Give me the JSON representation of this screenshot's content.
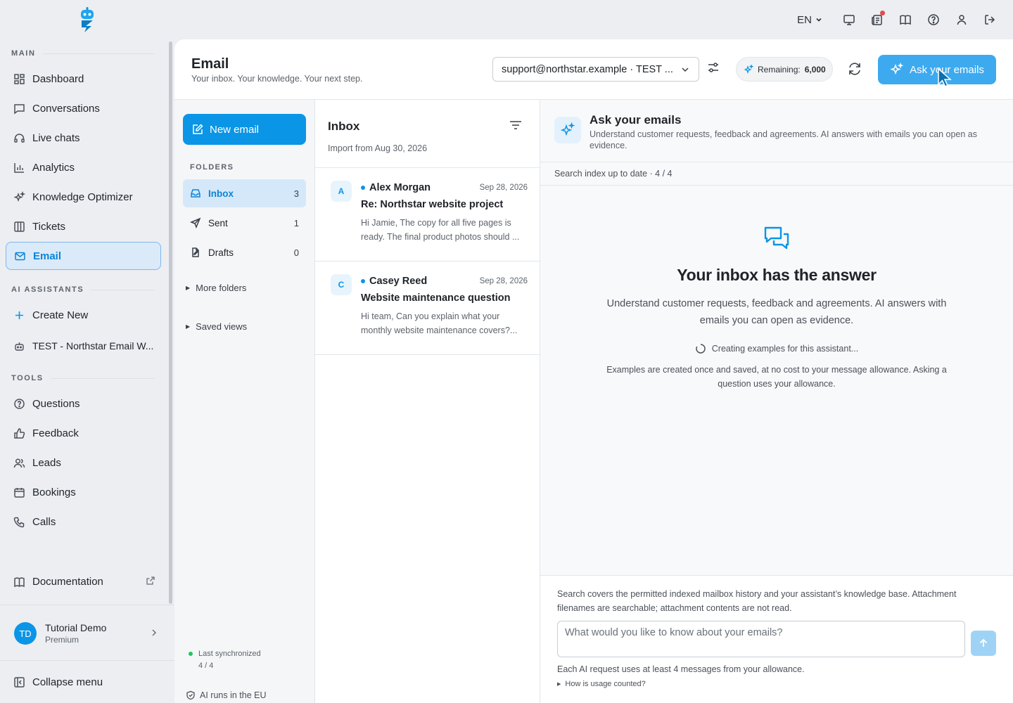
{
  "topbar": {
    "lang": "EN",
    "icons": [
      "monitor-icon",
      "news-icon",
      "book-icon",
      "help-icon",
      "user-icon",
      "logout-icon"
    ]
  },
  "sidebar": {
    "sections": {
      "main": "MAIN",
      "ai": "AI ASSISTANTS",
      "tools": "TOOLS"
    },
    "main_items": [
      {
        "label": "Dashboard",
        "icon": "dashboard-icon"
      },
      {
        "label": "Conversations",
        "icon": "conversations-icon"
      },
      {
        "label": "Live chats",
        "icon": "headset-icon"
      },
      {
        "label": "Analytics",
        "icon": "analytics-icon"
      },
      {
        "label": "Knowledge Optimizer",
        "icon": "sparkles-icon"
      },
      {
        "label": "Tickets",
        "icon": "tickets-icon"
      },
      {
        "label": "Email",
        "icon": "mail-icon"
      }
    ],
    "ai_items": [
      {
        "label": "Create New",
        "icon": "plus-icon"
      },
      {
        "label": "TEST - Northstar Email W...",
        "icon": "robot-icon"
      }
    ],
    "tool_items": [
      {
        "label": "Questions",
        "icon": "question-icon"
      },
      {
        "label": "Feedback",
        "icon": "thumbs-up-icon"
      },
      {
        "label": "Leads",
        "icon": "users-icon"
      },
      {
        "label": "Bookings",
        "icon": "calendar-icon"
      },
      {
        "label": "Calls",
        "icon": "phone-icon"
      }
    ],
    "documentation": "Documentation",
    "user": {
      "initials": "TD",
      "name": "Tutorial Demo",
      "plan": "Premium"
    },
    "collapse": "Collapse menu"
  },
  "header": {
    "title": "Email",
    "subtitle": "Your inbox. Your knowledge. Your next step.",
    "mailbox": "support@northstar.example · TEST ...",
    "remaining_label": "Remaining:",
    "remaining_value": "6,000",
    "ask_button": "Ask your emails",
    "accent": "#0b95e6"
  },
  "folders": {
    "new_email": "New email",
    "label": "FOLDERS",
    "items": [
      {
        "label": "Inbox",
        "count": "3"
      },
      {
        "label": "Sent",
        "count": "1"
      },
      {
        "label": "Drafts",
        "count": "0"
      }
    ],
    "more": "More folders",
    "saved": "Saved views",
    "sync_label": "Last synchronized",
    "sync_value": "4 / 4",
    "eu": "AI runs in the EU"
  },
  "inbox": {
    "title": "Inbox",
    "import": "Import from Aug 30, 2026",
    "messages": [
      {
        "initial": "A",
        "from": "Alex Morgan",
        "date": "Sep 28, 2026",
        "subject": "Re: Northstar website project",
        "preview": "Hi Jamie, The copy for all five pages is ready. The final product photos should ..."
      },
      {
        "initial": "C",
        "from": "Casey Reed",
        "date": "Sep 28, 2026",
        "subject": "Website maintenance question",
        "preview": "Hi team, Can you explain what your monthly website maintenance covers?..."
      }
    ]
  },
  "ask": {
    "title": "Ask your emails",
    "desc": "Understand customer requests, feedback and agreements. AI answers with emails you can open as evidence.",
    "index_status": "Search index up to date · 4 / 4",
    "empty_title": "Your inbox has the answer",
    "empty_desc": "Understand customer requests, feedback and agreements. AI answers with emails you can open as evidence.",
    "creating": "Creating examples for this assistant...",
    "examples_note": "Examples are created once and saved, at no cost to your message allowance. Asking a question uses your allowance.",
    "footer_note": "Search covers the permitted indexed mailbox history and your assistant’s knowledge base. Attachment filenames are searchable; attachment contents are not read.",
    "placeholder": "What would you like to know about your emails?",
    "usage": "Each AI request uses at least 4 messages from your allowance.",
    "usage_q": "How is usage counted?"
  }
}
